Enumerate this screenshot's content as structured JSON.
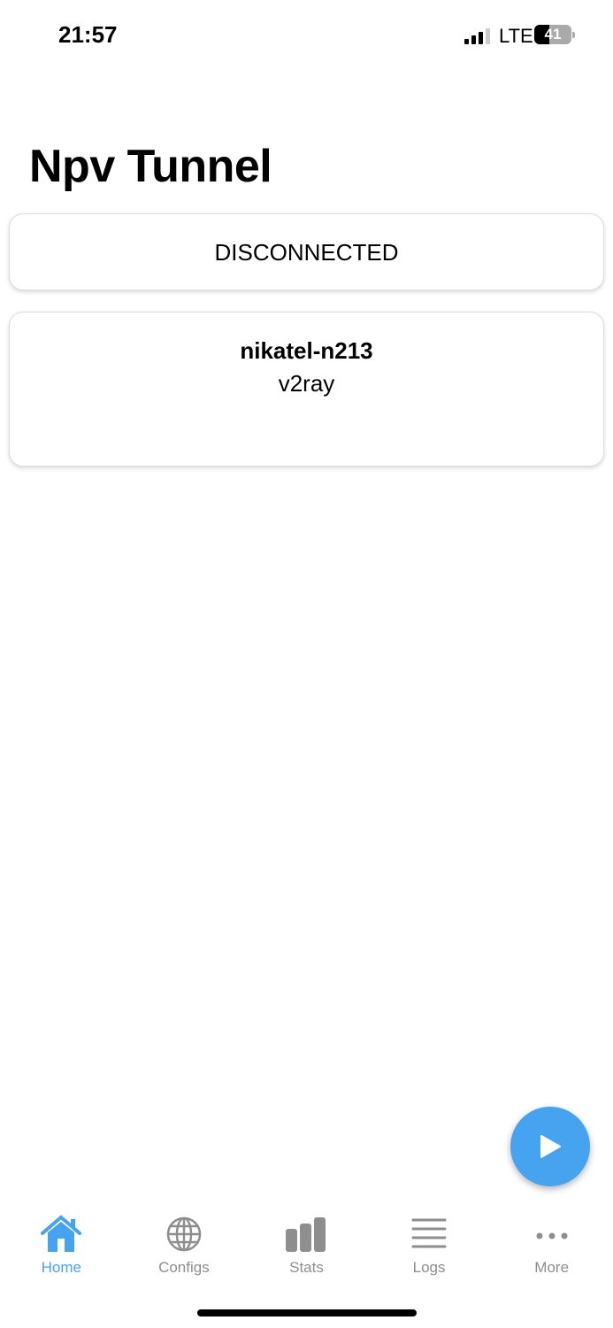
{
  "status_bar": {
    "time": "21:57",
    "network": "LTE",
    "battery": "41",
    "battery_level": 41
  },
  "header": {
    "title": "Npv Tunnel"
  },
  "connection": {
    "status": "DISCONNECTED"
  },
  "config": {
    "name": "nikatel-n213",
    "protocol": "v2ray"
  },
  "fab": {
    "icon": "play-icon"
  },
  "colors": {
    "accent": "#45a3ef",
    "inactive": "#8e8e8e"
  },
  "tabs": [
    {
      "label": "Home",
      "icon": "home-icon",
      "active": true
    },
    {
      "label": "Configs",
      "icon": "globe-icon"
    },
    {
      "label": "Stats",
      "icon": "bar-chart-icon"
    },
    {
      "label": "Logs",
      "icon": "list-icon"
    },
    {
      "label": "More",
      "icon": "more-icon"
    }
  ]
}
